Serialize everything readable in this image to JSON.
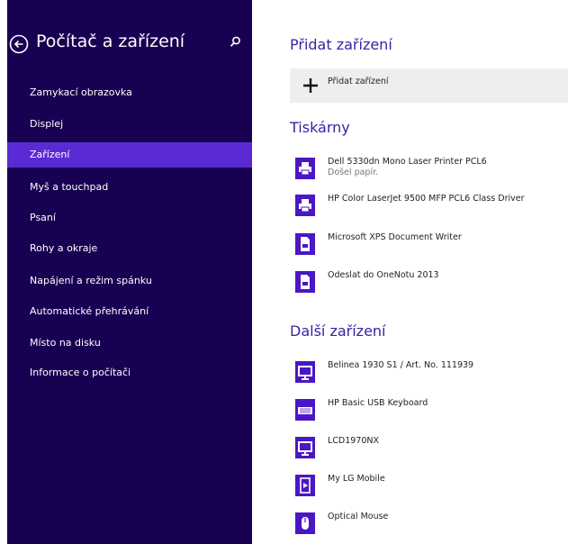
{
  "sidebar": {
    "title": "Počítač a zařízení",
    "items": [
      {
        "label": "Zamykací obrazovka",
        "selected": false
      },
      {
        "label": "Displej",
        "selected": false
      },
      {
        "label": "Zařízení",
        "selected": true
      },
      {
        "label": "Myš a touchpad",
        "selected": false
      },
      {
        "label": "Psaní",
        "selected": false
      },
      {
        "label": "Rohy a okraje",
        "selected": false
      },
      {
        "label": "Napájení a režim spánku",
        "selected": false
      },
      {
        "label": "Automatické přehrávání",
        "selected": false
      },
      {
        "label": "Místo na disku",
        "selected": false
      },
      {
        "label": "Informace o počítači",
        "selected": false
      }
    ]
  },
  "main": {
    "add_section_title": "Přidat zařízení",
    "add_button_label": "Přidat zařízení",
    "printers_title": "Tiskárny",
    "printers": [
      {
        "name": "Dell 5330dn Mono Laser Printer PCL6",
        "status": "Došel papír.",
        "icon": "printer-icon"
      },
      {
        "name": "HP Color LaserJet 9500 MFP PCL6 Class Driver",
        "status": "",
        "icon": "printer-icon"
      },
      {
        "name": "Microsoft XPS Document Writer",
        "status": "",
        "icon": "document-printer-icon"
      },
      {
        "name": "Odeslat do OneNotu 2013",
        "status": "",
        "icon": "document-printer-icon"
      }
    ],
    "other_title": "Další zařízení",
    "other_devices": [
      {
        "name": "Belinea 1930 S1 / Art. No. 111939",
        "icon": "monitor-icon"
      },
      {
        "name": "HP Basic USB Keyboard",
        "icon": "keyboard-icon"
      },
      {
        "name": "LCD1970NX",
        "icon": "monitor-icon"
      },
      {
        "name": "My LG Mobile",
        "icon": "media-player-icon"
      },
      {
        "name": "Optical Mouse",
        "icon": "mouse-icon"
      }
    ]
  },
  "colors": {
    "sidebar_bg": "#180052",
    "selected_bg": "#5a2bd4",
    "accent": "#4b16c5",
    "heading": "#3b1fa1"
  }
}
